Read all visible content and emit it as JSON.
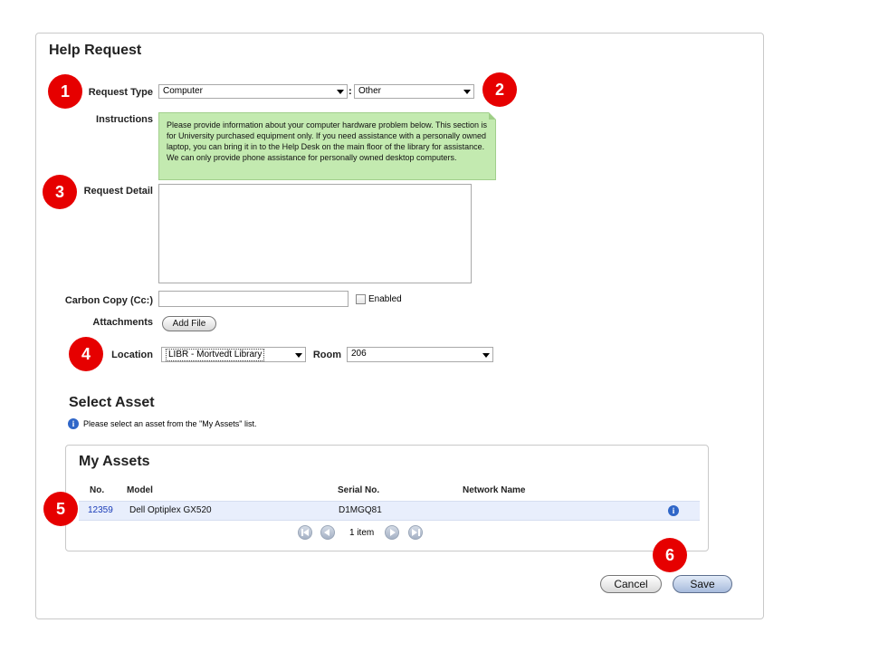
{
  "panel": {
    "title": "Help Request"
  },
  "form": {
    "request_type": {
      "label": "Request Type",
      "value": "Computer",
      "separator": ":",
      "subtype": "Other"
    },
    "instructions": {
      "label": "Instructions",
      "text": "Please provide information about your computer hardware problem below.  This section is for University purchased equipment only.  If you need assistance with a personally owned laptop, you can bring it in to the Help Desk on the main floor of the library for assistance.  We can only provide phone assistance for personally owned desktop computers."
    },
    "request_detail": {
      "label": "Request Detail",
      "value": ""
    },
    "cc": {
      "label": "Carbon Copy (Cc:)",
      "value": "",
      "enabled_label": "Enabled",
      "enabled": false
    },
    "attachments": {
      "label": "Attachments",
      "button": "Add File"
    },
    "location": {
      "label": "Location",
      "value": "LIBR - Mortvedt Library",
      "room_label": "Room",
      "room_value": "206"
    }
  },
  "select_asset": {
    "title": "Select Asset",
    "hint": "Please select an asset from the \"My Assets\" list."
  },
  "my_assets": {
    "title": "My Assets",
    "columns": [
      "No.",
      "Model",
      "Serial No.",
      "Network Name"
    ],
    "rows": [
      {
        "no": "12359",
        "model": "Dell Optiplex GX520",
        "serial": "D1MGQ81",
        "network": ""
      }
    ],
    "pager": {
      "text": "1 item"
    }
  },
  "actions": {
    "cancel": "Cancel",
    "save": "Save"
  },
  "callouts": [
    "1",
    "2",
    "3",
    "4",
    "5",
    "6"
  ],
  "colors": {
    "callout": "#e60000",
    "instructions_bg": "#c3eab0",
    "row_highlight": "#e8eefc",
    "link": "#1a3cb8"
  },
  "icons": [
    "info-icon",
    "first-page-icon",
    "prev-page-icon",
    "next-page-icon",
    "last-page-icon",
    "dropdown-arrow-icon"
  ]
}
